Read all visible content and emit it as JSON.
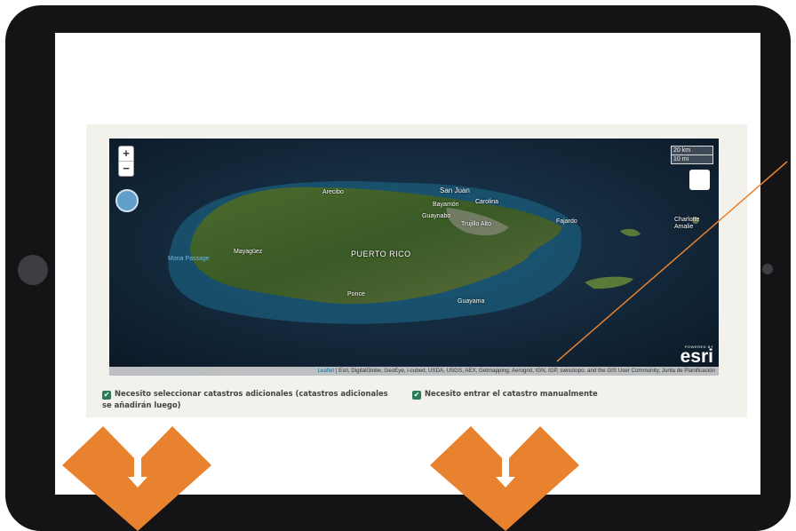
{
  "colors": {
    "frame": "#141417",
    "accent": "#e8822e",
    "checkbox": "#2d7a57",
    "panel": "#f2f1ec"
  },
  "map": {
    "zoom_in": "+",
    "zoom_out": "−",
    "scale": {
      "km": "20 km",
      "mi": "10 mi"
    },
    "labels": {
      "arecibo": "Arecibo",
      "san_juan": "San Juan",
      "bayamon": "Bayamón",
      "carolina": "Carolina",
      "guaynabo": "Guaynabo",
      "trujillo_alto": "Trujillo Alto",
      "fajardo": "Fajardo",
      "mayaguez": "Mayagüez",
      "puerto_rico": "PUERTO RICO",
      "ponce": "Ponce",
      "guayama": "Guayama",
      "mona_passage": "Mona Passage",
      "charlotte_amalie": "Charlotte Amalie"
    },
    "attribution_leaflet": "Leaflet",
    "attribution_text": " | Esri, DigitalGlobe, GeoEye, i-cubed, USDA, USGS, AEX, Getmapping, Aerogrid, IGN, IGP, swisstopo, and the GIS User Community, Junta de Planificación",
    "esri_powered": "POWERED BY",
    "esri_name": "esri"
  },
  "options": {
    "additional_label": "Necesito seleccionar catastros adicionales (catastros adicionales se añadirán luego)",
    "manual_label": "Necesito entrar el catastro manualmente",
    "check_mark": "✔"
  }
}
